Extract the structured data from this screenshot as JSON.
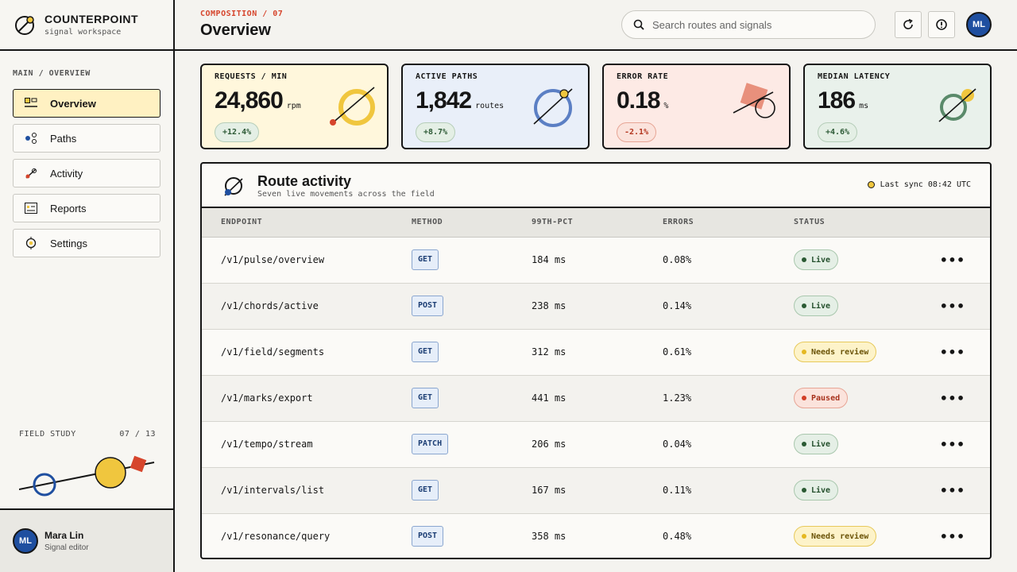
{
  "brand": {
    "name": "COUNTERPOINT",
    "subtitle": "signal workspace"
  },
  "sidebar": {
    "section_label": "MAIN / OVERVIEW",
    "items": [
      {
        "label": "Overview",
        "icon": "overview-icon",
        "active": true
      },
      {
        "label": "Paths",
        "icon": "paths-icon"
      },
      {
        "label": "Activity",
        "icon": "activity-icon"
      },
      {
        "label": "Reports",
        "icon": "reports-icon"
      },
      {
        "label": "Settings",
        "icon": "settings-icon"
      }
    ],
    "study": {
      "label": "FIELD STUDY",
      "count": "07 / 13"
    }
  },
  "user": {
    "initials": "ML",
    "name": "Mara Lin",
    "role": "Signal editor"
  },
  "header": {
    "eyebrow": "COMPOSITION / 07",
    "title": "Overview",
    "search_placeholder": "Search routes and signals",
    "avatar_initials": "ML"
  },
  "kpis": [
    {
      "label": "REQUESTS / MIN",
      "value": "24,860",
      "unit": "rpm",
      "delta": "+12.4%",
      "trend": "up",
      "bg": "#fff7dc"
    },
    {
      "label": "ACTIVE PATHS",
      "value": "1,842",
      "unit": "routes",
      "delta": "+8.7%",
      "trend": "up",
      "bg": "#e9eff9"
    },
    {
      "label": "ERROR RATE",
      "value": "0.18",
      "unit": "%",
      "delta": "-2.1%",
      "trend": "down",
      "bg": "#fdeae5"
    },
    {
      "label": "MEDIAN LATENCY",
      "value": "186",
      "unit": "ms",
      "delta": "+4.6%",
      "trend": "up",
      "bg": "#e9f1eb"
    }
  ],
  "activity": {
    "title": "Route activity",
    "subtitle": "Seven live movements across the field",
    "sync": "Last sync 08:42 UTC",
    "columns": [
      "ENDPOINT",
      "METHOD",
      "99TH-PCT",
      "ERRORS",
      "STATUS"
    ],
    "rows": [
      {
        "endpoint": "/v1/pulse/overview",
        "method": "GET",
        "p99": "184 ms",
        "errors": "0.08%",
        "status": "Live"
      },
      {
        "endpoint": "/v1/chords/active",
        "method": "POST",
        "p99": "238 ms",
        "errors": "0.14%",
        "status": "Live"
      },
      {
        "endpoint": "/v1/field/segments",
        "method": "GET",
        "p99": "312 ms",
        "errors": "0.61%",
        "status": "Needs review"
      },
      {
        "endpoint": "/v1/marks/export",
        "method": "GET",
        "p99": "441 ms",
        "errors": "1.23%",
        "status": "Paused"
      },
      {
        "endpoint": "/v1/tempo/stream",
        "method": "PATCH",
        "p99": "206 ms",
        "errors": "0.04%",
        "status": "Live"
      },
      {
        "endpoint": "/v1/intervals/list",
        "method": "GET",
        "p99": "167 ms",
        "errors": "0.11%",
        "status": "Live"
      },
      {
        "endpoint": "/v1/resonance/query",
        "method": "POST",
        "p99": "358 ms",
        "errors": "0.48%",
        "status": "Needs review"
      }
    ]
  },
  "colors": {
    "accent_red": "#d6452c",
    "accent_yellow": "#f0c63e",
    "accent_blue": "#1f4fa0",
    "accent_green": "#5a8a6a",
    "ink": "#161616"
  }
}
